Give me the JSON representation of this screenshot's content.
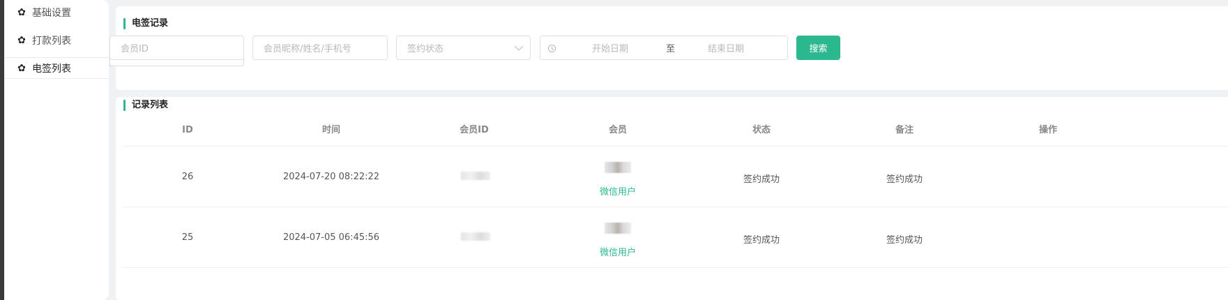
{
  "sidebar": {
    "items": [
      {
        "label": "基础设置",
        "icon": "gear-icon",
        "active": false
      },
      {
        "label": "打款列表",
        "icon": "gear-icon",
        "active": false
      },
      {
        "label": "电签列表",
        "icon": "gear-icon",
        "active": true
      }
    ]
  },
  "search_card": {
    "title": "电签记录",
    "member_id_placeholder": "会员ID",
    "member_name_placeholder": "会员昵称/姓名/手机号",
    "status_placeholder": "签约状态",
    "date_start_placeholder": "开始日期",
    "date_separator": "至",
    "date_end_placeholder": "结束日期",
    "search_button": "搜索"
  },
  "records_card": {
    "title": "记录列表",
    "columns": [
      "ID",
      "时间",
      "会员ID",
      "会员",
      "状态",
      "备注",
      "操作"
    ],
    "rows": [
      {
        "id": "26",
        "time": "2024-07-20 08:22:22",
        "member_type": "微信用户",
        "status": "签约成功",
        "note": "签约成功"
      },
      {
        "id": "25",
        "time": "2024-07-05 06:45:56",
        "member_type": "微信用户",
        "status": "签约成功",
        "note": "签约成功"
      }
    ]
  },
  "colors": {
    "accent": "#2bb88f",
    "page_bg": "#eef2f5",
    "card_bg": "#ffffff"
  }
}
